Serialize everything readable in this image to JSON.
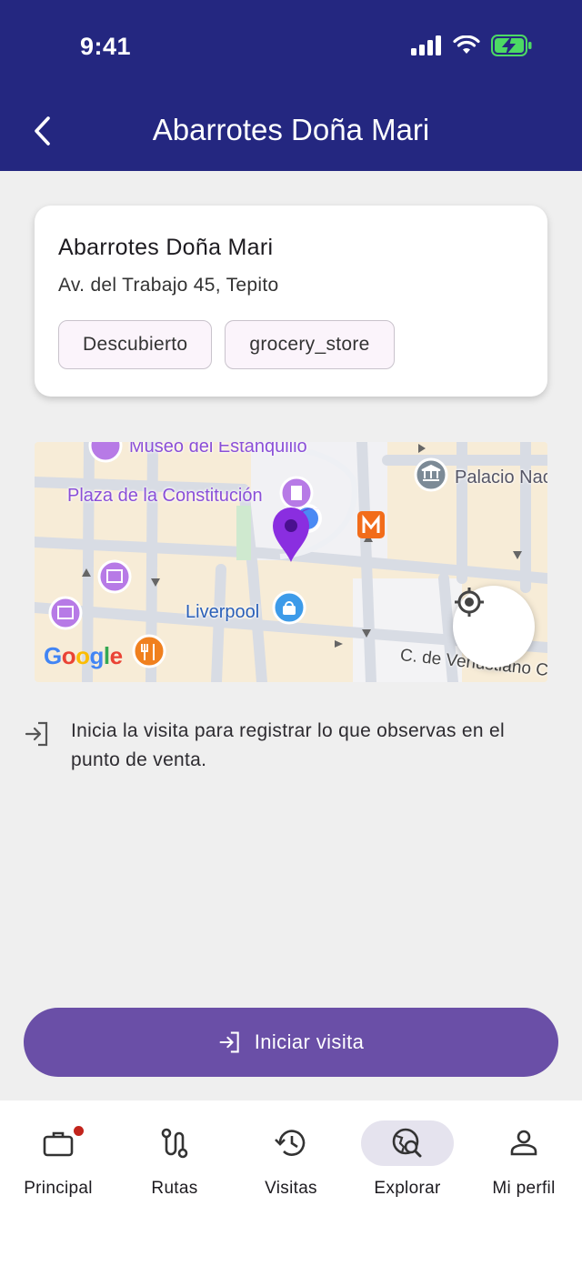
{
  "status_bar": {
    "time": "9:41"
  },
  "header": {
    "title": "Abarrotes Doña Mari"
  },
  "store": {
    "name": "Abarrotes Doña Mari",
    "address": "Av. del Trabajo 45, Tepito",
    "tags": [
      "Descubierto",
      "grocery_store"
    ]
  },
  "map": {
    "labels": {
      "museo": "Museo del Estanquillo",
      "plaza": "Plaza de la Constitución",
      "palacio": "Palacio Nac",
      "liverpool": "Liverpool",
      "street": "C. de Venustiano C",
      "google": "Google"
    }
  },
  "info": {
    "text": "Inicia la visita para registrar lo que observas en el punto de venta."
  },
  "actions": {
    "start_visit": "Iniciar visita"
  },
  "nav": {
    "items": [
      {
        "label": "Principal"
      },
      {
        "label": "Rutas"
      },
      {
        "label": "Visitas"
      },
      {
        "label": "Explorar"
      },
      {
        "label": "Mi perfil"
      }
    ],
    "active": "Explorar"
  },
  "colors": {
    "header_bg": "#242780",
    "primary_button": "#6a4fa7",
    "map_pin": "#8a2ee0",
    "notification_dot": "#c2241c"
  }
}
